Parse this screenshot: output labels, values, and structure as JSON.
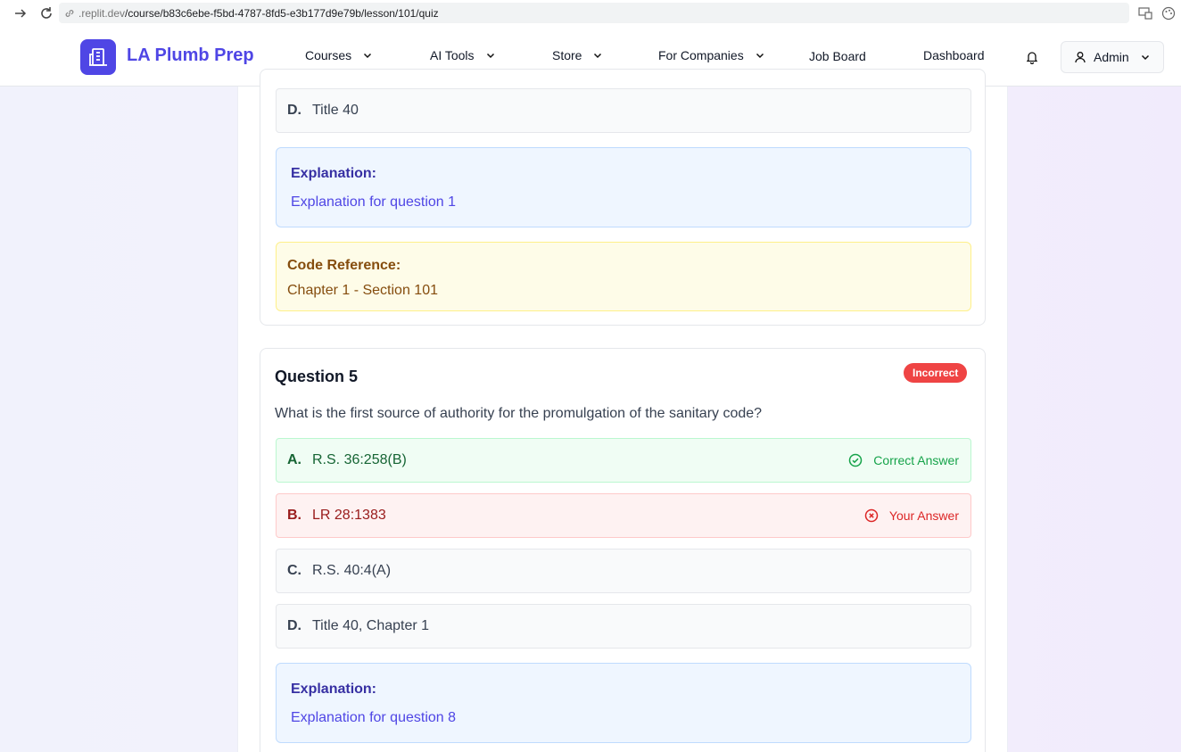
{
  "browser": {
    "url_host": ".replit.dev",
    "url_path": "/course/b83c6ebe-f5bd-4787-8fd5-e3b177d9e79b/lesson/101/quiz"
  },
  "header": {
    "brand": "LA Plumb Prep",
    "nav": {
      "courses": "Courses",
      "ai_tools": "AI Tools",
      "store": "Store",
      "for_companies": "For Companies",
      "job_board": "Job Board",
      "dashboard": "Dashboard"
    },
    "admin_label": "Admin"
  },
  "previous_question": {
    "option_d": {
      "letter": "D.",
      "text": "Title 40"
    },
    "explanation_title": "Explanation:",
    "explanation_text": "Explanation for question 1",
    "code_reference_title": "Code Reference:",
    "code_reference_text": "Chapter 1 - Section 101"
  },
  "question5": {
    "title": "Question 5",
    "badge": "Incorrect",
    "text": "What is the first source of authority for the promulgation of the sanitary code?",
    "options": [
      {
        "letter": "A.",
        "text": "R.S. 36:258(B)",
        "status": "Correct Answer"
      },
      {
        "letter": "B.",
        "text": "LR 28:1383",
        "status": "Your Answer"
      },
      {
        "letter": "C.",
        "text": "R.S. 40:4(A)"
      },
      {
        "letter": "D.",
        "text": "Title 40, Chapter 1"
      }
    ],
    "explanation_title": "Explanation:",
    "explanation_text": "Explanation for question 8"
  },
  "colors": {
    "brand": "#4f46e5",
    "incorrect": "#ef4444",
    "correct": "#16a34a"
  }
}
